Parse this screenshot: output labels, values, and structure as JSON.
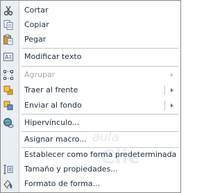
{
  "menu": {
    "items": [
      {
        "label": "Cortar",
        "icon": "scissors-icon",
        "disabled": false,
        "submenu": false
      },
      {
        "label": "Copiar",
        "icon": "copy-icon",
        "disabled": false,
        "submenu": false
      },
      {
        "label": "Pegar",
        "icon": "paste-icon",
        "disabled": false,
        "submenu": false
      },
      {
        "label": "Modificar texto",
        "icon": "edit-text-icon",
        "disabled": false,
        "submenu": false
      },
      {
        "label": "Agrupar",
        "icon": "group-icon",
        "disabled": true,
        "submenu": true
      },
      {
        "label": "Traer al frente",
        "icon": "bring-to-front-icon",
        "disabled": false,
        "submenu": true
      },
      {
        "label": "Enviar al fondo",
        "icon": "send-to-back-icon",
        "disabled": false,
        "submenu": true
      },
      {
        "label": "Hipervínculo...",
        "icon": "hyperlink-icon",
        "disabled": false,
        "submenu": false
      },
      {
        "label": "Asignar macro...",
        "icon": "",
        "disabled": false,
        "submenu": false
      },
      {
        "label": "Establecer como forma predeterminada",
        "icon": "",
        "disabled": false,
        "submenu": false
      },
      {
        "label": "Tamaño y propiedades...",
        "icon": "size-properties-icon",
        "disabled": false,
        "submenu": false
      },
      {
        "label": "Formato de forma...",
        "icon": "format-shape-icon",
        "disabled": false,
        "submenu": false
      }
    ]
  },
  "watermark": {
    "line1": "aula",
    "line2": "Clic"
  }
}
